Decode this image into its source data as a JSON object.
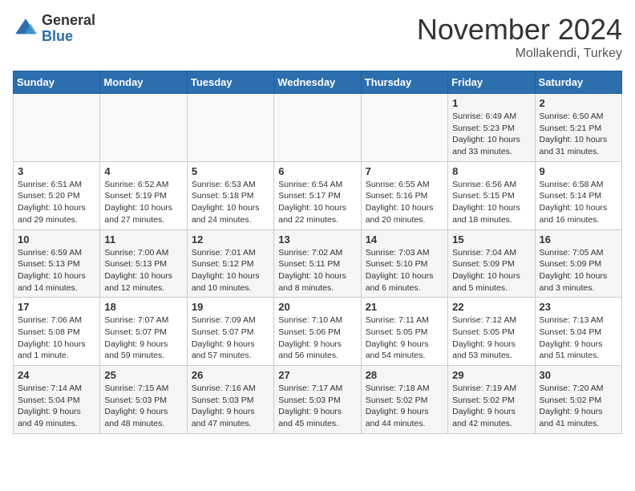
{
  "header": {
    "logo_general": "General",
    "logo_blue": "Blue",
    "month": "November 2024",
    "location": "Mollakendi, Turkey"
  },
  "days_of_week": [
    "Sunday",
    "Monday",
    "Tuesday",
    "Wednesday",
    "Thursday",
    "Friday",
    "Saturday"
  ],
  "weeks": [
    [
      {
        "day": "",
        "info": ""
      },
      {
        "day": "",
        "info": ""
      },
      {
        "day": "",
        "info": ""
      },
      {
        "day": "",
        "info": ""
      },
      {
        "day": "",
        "info": ""
      },
      {
        "day": "1",
        "info": "Sunrise: 6:49 AM\nSunset: 5:23 PM\nDaylight: 10 hours\nand 33 minutes."
      },
      {
        "day": "2",
        "info": "Sunrise: 6:50 AM\nSunset: 5:21 PM\nDaylight: 10 hours\nand 31 minutes."
      }
    ],
    [
      {
        "day": "3",
        "info": "Sunrise: 6:51 AM\nSunset: 5:20 PM\nDaylight: 10 hours\nand 29 minutes."
      },
      {
        "day": "4",
        "info": "Sunrise: 6:52 AM\nSunset: 5:19 PM\nDaylight: 10 hours\nand 27 minutes."
      },
      {
        "day": "5",
        "info": "Sunrise: 6:53 AM\nSunset: 5:18 PM\nDaylight: 10 hours\nand 24 minutes."
      },
      {
        "day": "6",
        "info": "Sunrise: 6:54 AM\nSunset: 5:17 PM\nDaylight: 10 hours\nand 22 minutes."
      },
      {
        "day": "7",
        "info": "Sunrise: 6:55 AM\nSunset: 5:16 PM\nDaylight: 10 hours\nand 20 minutes."
      },
      {
        "day": "8",
        "info": "Sunrise: 6:56 AM\nSunset: 5:15 PM\nDaylight: 10 hours\nand 18 minutes."
      },
      {
        "day": "9",
        "info": "Sunrise: 6:58 AM\nSunset: 5:14 PM\nDaylight: 10 hours\nand 16 minutes."
      }
    ],
    [
      {
        "day": "10",
        "info": "Sunrise: 6:59 AM\nSunset: 5:13 PM\nDaylight: 10 hours\nand 14 minutes."
      },
      {
        "day": "11",
        "info": "Sunrise: 7:00 AM\nSunset: 5:13 PM\nDaylight: 10 hours\nand 12 minutes."
      },
      {
        "day": "12",
        "info": "Sunrise: 7:01 AM\nSunset: 5:12 PM\nDaylight: 10 hours\nand 10 minutes."
      },
      {
        "day": "13",
        "info": "Sunrise: 7:02 AM\nSunset: 5:11 PM\nDaylight: 10 hours\nand 8 minutes."
      },
      {
        "day": "14",
        "info": "Sunrise: 7:03 AM\nSunset: 5:10 PM\nDaylight: 10 hours\nand 6 minutes."
      },
      {
        "day": "15",
        "info": "Sunrise: 7:04 AM\nSunset: 5:09 PM\nDaylight: 10 hours\nand 5 minutes."
      },
      {
        "day": "16",
        "info": "Sunrise: 7:05 AM\nSunset: 5:09 PM\nDaylight: 10 hours\nand 3 minutes."
      }
    ],
    [
      {
        "day": "17",
        "info": "Sunrise: 7:06 AM\nSunset: 5:08 PM\nDaylight: 10 hours\nand 1 minute."
      },
      {
        "day": "18",
        "info": "Sunrise: 7:07 AM\nSunset: 5:07 PM\nDaylight: 9 hours\nand 59 minutes."
      },
      {
        "day": "19",
        "info": "Sunrise: 7:09 AM\nSunset: 5:07 PM\nDaylight: 9 hours\nand 57 minutes."
      },
      {
        "day": "20",
        "info": "Sunrise: 7:10 AM\nSunset: 5:06 PM\nDaylight: 9 hours\nand 56 minutes."
      },
      {
        "day": "21",
        "info": "Sunrise: 7:11 AM\nSunset: 5:05 PM\nDaylight: 9 hours\nand 54 minutes."
      },
      {
        "day": "22",
        "info": "Sunrise: 7:12 AM\nSunset: 5:05 PM\nDaylight: 9 hours\nand 53 minutes."
      },
      {
        "day": "23",
        "info": "Sunrise: 7:13 AM\nSunset: 5:04 PM\nDaylight: 9 hours\nand 51 minutes."
      }
    ],
    [
      {
        "day": "24",
        "info": "Sunrise: 7:14 AM\nSunset: 5:04 PM\nDaylight: 9 hours\nand 49 minutes."
      },
      {
        "day": "25",
        "info": "Sunrise: 7:15 AM\nSunset: 5:03 PM\nDaylight: 9 hours\nand 48 minutes."
      },
      {
        "day": "26",
        "info": "Sunrise: 7:16 AM\nSunset: 5:03 PM\nDaylight: 9 hours\nand 47 minutes."
      },
      {
        "day": "27",
        "info": "Sunrise: 7:17 AM\nSunset: 5:03 PM\nDaylight: 9 hours\nand 45 minutes."
      },
      {
        "day": "28",
        "info": "Sunrise: 7:18 AM\nSunset: 5:02 PM\nDaylight: 9 hours\nand 44 minutes."
      },
      {
        "day": "29",
        "info": "Sunrise: 7:19 AM\nSunset: 5:02 PM\nDaylight: 9 hours\nand 42 minutes."
      },
      {
        "day": "30",
        "info": "Sunrise: 7:20 AM\nSunset: 5:02 PM\nDaylight: 9 hours\nand 41 minutes."
      }
    ]
  ]
}
